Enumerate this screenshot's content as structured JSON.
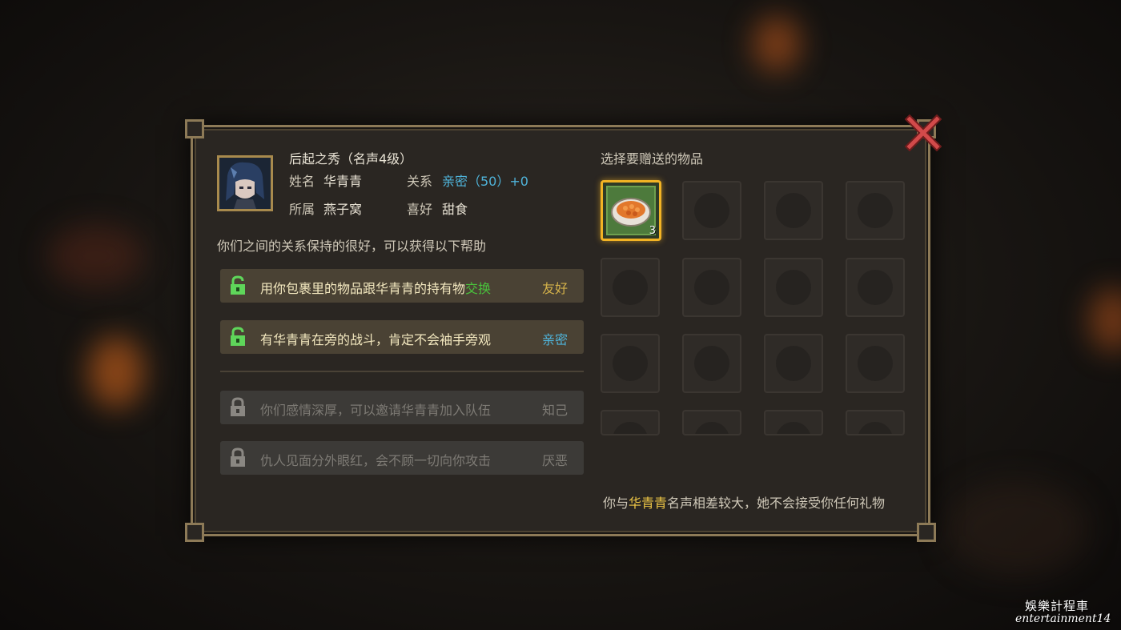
{
  "header": {
    "title": "后起之秀（名声4级）",
    "name_label": "姓名",
    "name_value": "华青青",
    "relation_label": "关系",
    "relation_value": "亲密（50）+0",
    "faction_label": "所属",
    "faction_value": "燕子窝",
    "hobby_label": "喜好",
    "hobby_value": "甜食"
  },
  "intro": "你们之间的关系保持的很好，可以获得以下帮助",
  "help_items": [
    {
      "text_a": "用你包裹里的物品跟华青青的持有物",
      "text_b": "交换",
      "relation": "友好",
      "status": "unlocked"
    },
    {
      "text_a": "有华青青在旁的战斗，肯定不会袖手旁观",
      "text_b": "",
      "relation": "亲密",
      "status": "unlocked"
    },
    {
      "text_a": "你们感情深厚，可以邀请华青青加入队伍",
      "text_b": "",
      "relation": "知己",
      "status": "locked"
    },
    {
      "text_a": "仇人见面分外眼红，会不顾一切向你攻击",
      "text_b": "",
      "relation": "厌恶",
      "status": "locked"
    }
  ],
  "gift": {
    "title": "选择要赠送的物品",
    "selected_item_count": "3",
    "footer_prefix": "你与",
    "footer_name": "华青青",
    "footer_suffix": "名声相差较大，她不会接受你任何礼物"
  },
  "watermark": {
    "line1": "娛樂計程車",
    "line2": "entertainment14"
  },
  "colors": {
    "accent_gold": "#f0c846",
    "relation_blue": "#4fb3d9",
    "exchange_green": "#49c33c",
    "panel_border": "#8d7a57"
  }
}
